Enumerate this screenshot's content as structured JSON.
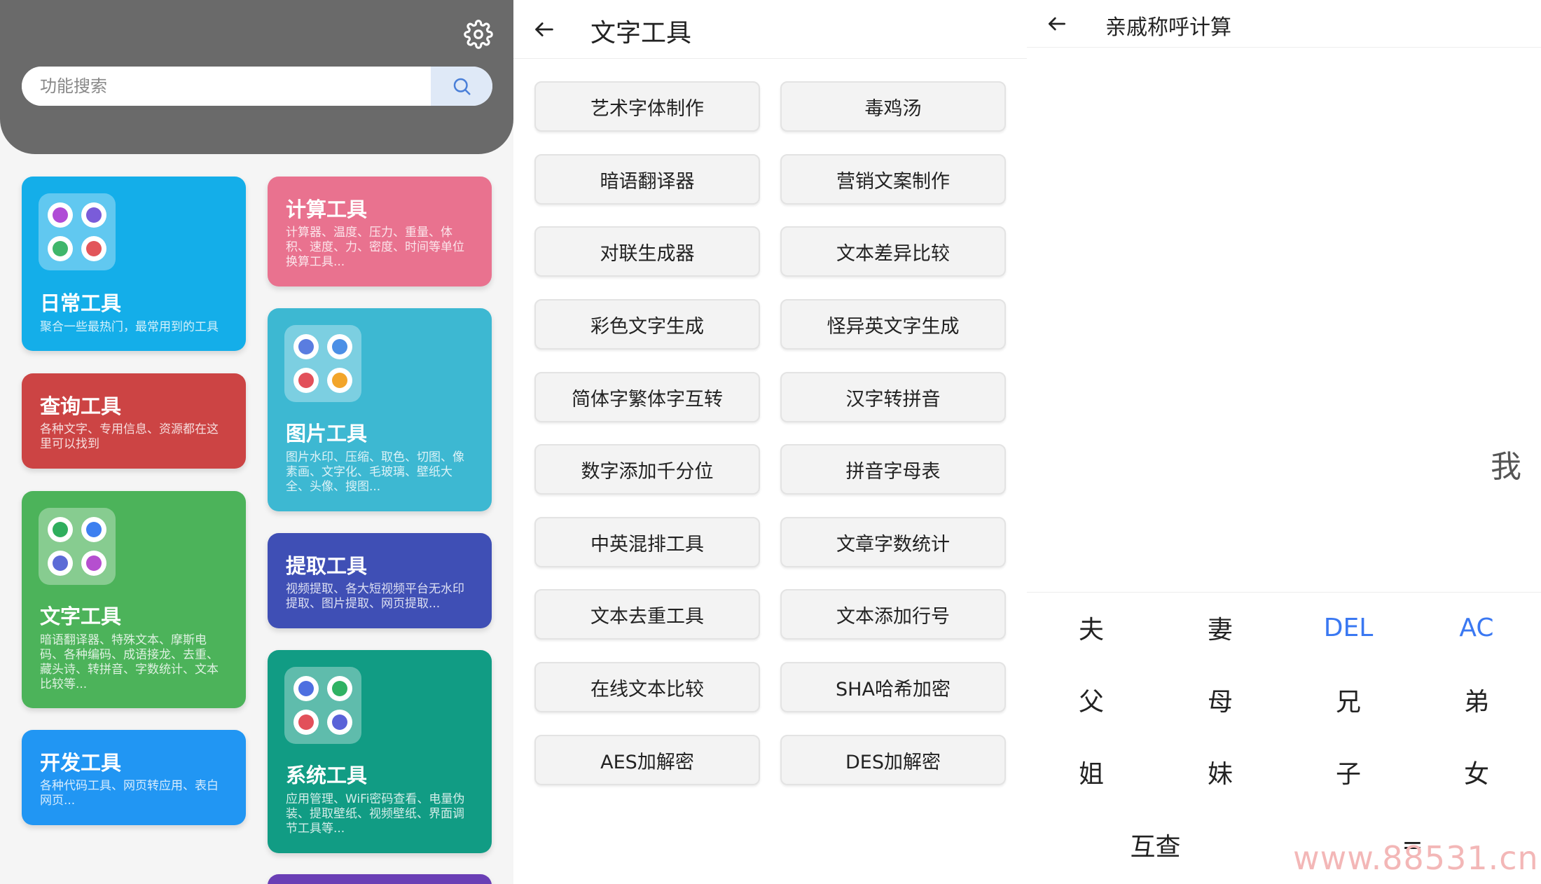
{
  "home": {
    "search": {
      "placeholder": "功能搜索"
    },
    "cards": {
      "daily": {
        "title": "日常工具",
        "desc": "聚合一些最热门，最常用到的工具",
        "color": "#14aee9"
      },
      "calc": {
        "title": "计算工具",
        "desc": "计算器、温度、压力、重量、体积、速度、力、密度、时间等单位换算工具...",
        "color": "#e9728f"
      },
      "query": {
        "title": "查询工具",
        "desc": "各种文字、专用信息、资源都在这里可以找到",
        "color": "#cc4444"
      },
      "image": {
        "title": "图片工具",
        "desc": "图片水印、压缩、取色、切图、像素画、文字化、毛玻璃、壁纸大全、头像、搜图...",
        "color": "#3db8d2"
      },
      "text": {
        "title": "文字工具",
        "desc": "暗语翻译器、特殊文本、摩斯电码、各种编码、成语接龙、去重、藏头诗、转拼音、字数统计、文本比较等...",
        "color": "#4cb35a"
      },
      "extract": {
        "title": "提取工具",
        "desc": "视频提取、各大短视频平台无水印提取、图片提取、网页提取...",
        "color": "#3f4fb5"
      },
      "dev": {
        "title": "开发工具",
        "desc": "各种代码工具、网页转应用、表白网页...",
        "color": "#2196f3"
      },
      "system": {
        "title": "系统工具",
        "desc": "应用管理、WiFi密码查看、电量伪装、提取壁纸、视频壁纸、界面调节工具等...",
        "color": "#119c84"
      }
    }
  },
  "text_tools": {
    "title": "文字工具",
    "buttons": [
      "艺术字体制作",
      "毒鸡汤",
      "暗语翻译器",
      "营销文案制作",
      "对联生成器",
      "文本差异比较",
      "彩色文字生成",
      "怪异英文字生成",
      "简体字繁体字互转",
      "汉字转拼音",
      "数字添加千分位",
      "拼音字母表",
      "中英混排工具",
      "文章字数统计",
      "文本去重工具",
      "文本添加行号",
      "在线文本比较",
      "SHA哈希加密",
      "AES加解密",
      "DES加解密"
    ]
  },
  "kinship": {
    "title": "亲戚称呼计算",
    "display": "我",
    "keys": {
      "husband": "夫",
      "wife": "妻",
      "del": "DEL",
      "ac": "AC",
      "father": "父",
      "mother": "母",
      "elder_brother": "兄",
      "younger_brother": "弟",
      "elder_sister": "姐",
      "younger_sister": "妹",
      "son": "子",
      "daughter": "女",
      "mutual": "互查",
      "equals": "="
    },
    "accent_color": "#3a78f2"
  },
  "watermark": "www.88531.cn"
}
